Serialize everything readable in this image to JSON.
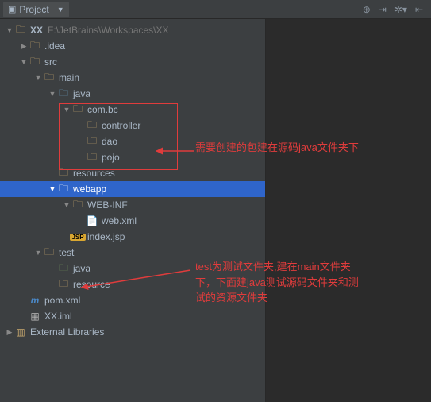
{
  "toolbar": {
    "title": "Project"
  },
  "project": {
    "name": "XX",
    "path": "F:\\JetBrains\\Workspaces\\XX"
  },
  "tree": {
    "idea": ".idea",
    "src": "src",
    "main": "main",
    "java": "java",
    "com_bc": "com.bc",
    "controller": "controller",
    "dao": "dao",
    "pojo": "pojo",
    "resources": "resources",
    "webapp": "webapp",
    "webinf": "WEB-INF",
    "webxml": "web.xml",
    "indexjsp": "index.jsp",
    "test": "test",
    "test_java": "java",
    "test_resource": "resource",
    "pom": "pom.xml",
    "iml": "XX.iml",
    "ext_lib": "External Libraries"
  },
  "annotations": {
    "anno1": "需要创建的包建在源码java文件夹下",
    "anno2_l1": "test为测试文件夹,建在main文件夹",
    "anno2_l2": "下，下面建java测试源码文件夹和测",
    "anno2_l3": "试的资源文件夹"
  }
}
